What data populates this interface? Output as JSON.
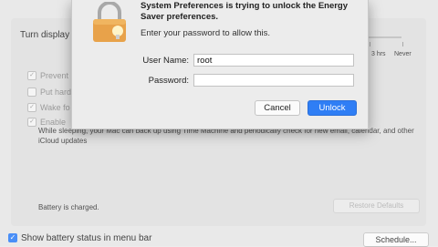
{
  "background": {
    "turn_display_label": "Turn display",
    "scale": {
      "hrs_label": "3 hrs",
      "never_label": "Never"
    },
    "options": [
      {
        "label": "Prevent",
        "checked": true
      },
      {
        "label": "Put hard",
        "checked": false
      },
      {
        "label": "Wake fo",
        "checked": true
      },
      {
        "label": "Enable",
        "checked": true
      }
    ],
    "power_nap_description": "While sleeping, your Mac can back up using Time Machine and periodically check for new email, calendar, and other iCloud updates",
    "battery_status": "Battery is charged.",
    "restore_defaults_label": "Restore Defaults",
    "show_battery_label": "Show battery status in menu bar",
    "show_battery_checked": true,
    "schedule_label": "Schedule..."
  },
  "dialog": {
    "title": "System Preferences is trying to unlock the Energy Saver preferences.",
    "subtitle": "Enter your password to allow this.",
    "username_label": "User Name:",
    "username_value": "root",
    "password_label": "Password:",
    "password_value": "",
    "cancel_label": "Cancel",
    "unlock_label": "Unlock",
    "lock_icon": "lock-icon"
  },
  "colors": {
    "accent": "#2f7ef5",
    "lock_body": "#e8a24a"
  }
}
